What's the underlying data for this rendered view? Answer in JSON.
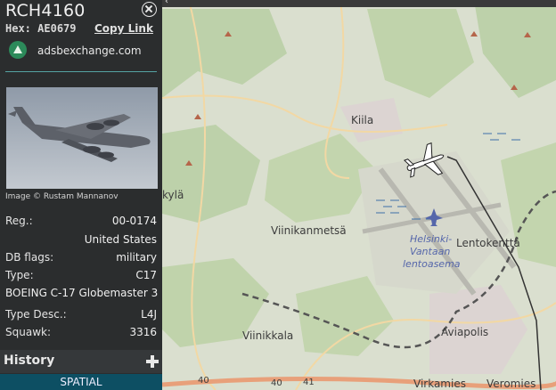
{
  "aircraft": {
    "callsign": "RCH4160",
    "hex_label": "Hex:",
    "hex": "AE0679",
    "copy_link": "Copy Link",
    "source": "adsbexchange.com",
    "image_credit": "Image © Rustam Mannanov"
  },
  "details": {
    "reg_label": "Reg.:",
    "reg": "00-0174",
    "country": "United States",
    "db_flags_label": "DB flags:",
    "db_flags": "military",
    "type_label": "Type:",
    "type": "C17",
    "model": "BOEING C-17 Globemaster 3",
    "type_desc_label": "Type Desc.:",
    "type_desc": "L4J",
    "squawk_label": "Squawk:",
    "squawk": "3316"
  },
  "history": {
    "title": "History"
  },
  "tab": {
    "spatial": "SPATIAL"
  },
  "map": {
    "labels": {
      "kiila": "Kiila",
      "kyla": "kylä",
      "viinikanmetsa": "Viinikanmetsä",
      "helsinki_vantaa_1": "Helsinki-",
      "helsinki_vantaa_2": "Vantaan",
      "helsinki_vantaa_3": "lentoasema",
      "lentokentta": "Lentokenttä",
      "viinikkala": "Viinikkala",
      "aviapolis": "Aviapolis",
      "virkamies": "Virkamies",
      "veromies": "Veromies",
      "road_40_a": "40",
      "road_40_b": "40",
      "road_41": "41"
    },
    "colors": {
      "forest": "#b9cfa6",
      "field": "#e2e2cc",
      "urban": "#d9d3d0",
      "water_marks": "#3d6fa8",
      "railway": "#555555",
      "road": "#f2d8a4",
      "highway": "#e8a07a",
      "track": "#333333"
    }
  }
}
